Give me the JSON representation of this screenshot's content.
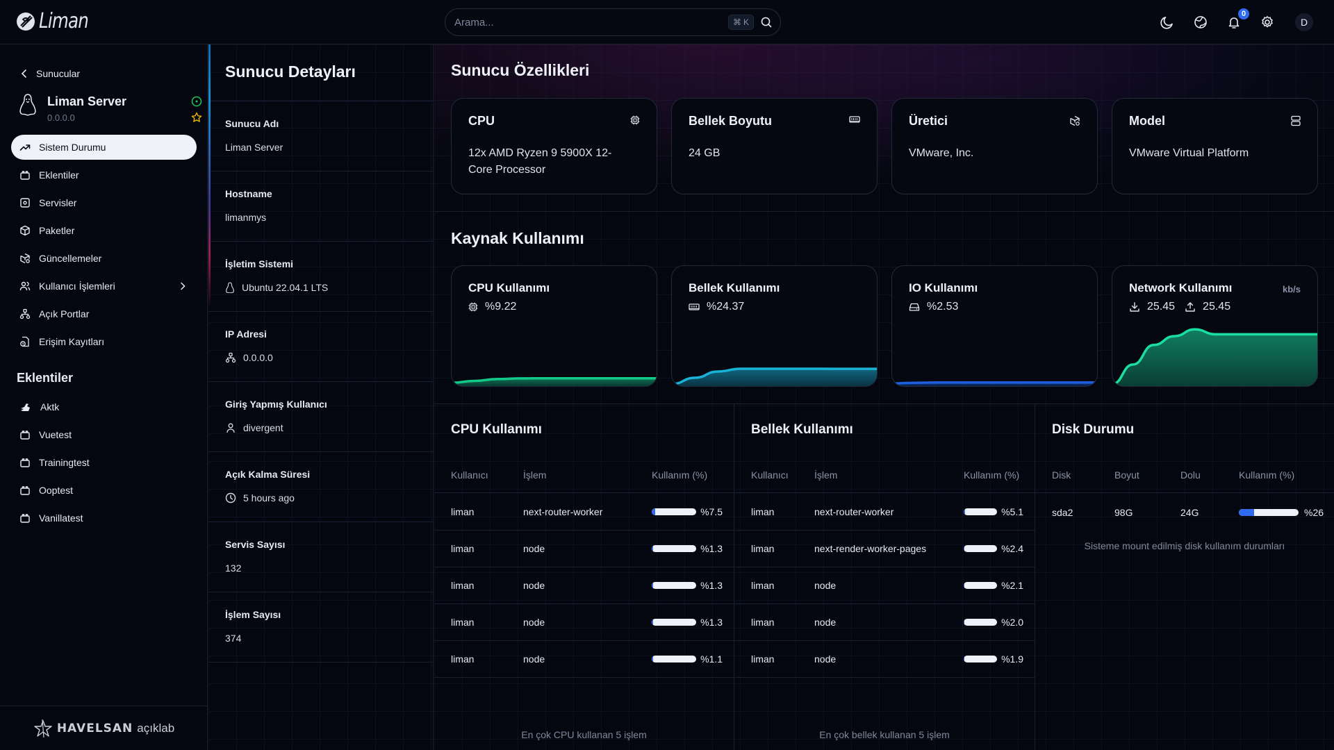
{
  "app": {
    "name": "Liman"
  },
  "search": {
    "placeholder": "Arama...",
    "shortcut_key": "K"
  },
  "topbar": {
    "notification_count": "0",
    "avatar_initial": "D"
  },
  "sidebar": {
    "back_label": "Sunucular",
    "server_name": "Liman Server",
    "server_ip": "0.0.0.0",
    "nav": [
      {
        "label": "Sistem Durumu",
        "icon": "trend-icon",
        "active": true
      },
      {
        "label": "Eklentiler",
        "icon": "plugin-icon"
      },
      {
        "label": "Servisler",
        "icon": "service-icon"
      },
      {
        "label": "Paketler",
        "icon": "package-icon"
      },
      {
        "label": "Güncellemeler",
        "icon": "update-icon"
      },
      {
        "label": "Kullanıcı İşlemleri",
        "icon": "users-icon",
        "has_submenu": true
      },
      {
        "label": "Açık Portlar",
        "icon": "network-icon"
      },
      {
        "label": "Erişim Kayıtları",
        "icon": "log-icon"
      }
    ],
    "plugins_title": "Eklentiler",
    "plugins": [
      {
        "label": "Aktk",
        "icon": "aktk-icon"
      },
      {
        "label": "Vuetest",
        "icon": "plugin-icon"
      },
      {
        "label": "Trainingtest",
        "icon": "plugin-icon"
      },
      {
        "label": "Ooptest",
        "icon": "plugin-icon"
      },
      {
        "label": "Vanillatest",
        "icon": "plugin-icon"
      }
    ],
    "footer": {
      "brand": "HAVELSAN",
      "sub": "açıklab"
    }
  },
  "details": {
    "title": "Sunucu Detayları",
    "items": [
      {
        "label": "Sunucu Adı",
        "value": "Liman Server"
      },
      {
        "label": "Hostname",
        "value": "limanmys"
      },
      {
        "label": "İşletim Sistemi",
        "value": "Ubuntu 22.04.1 LTS",
        "icon": "linux-icon"
      },
      {
        "label": "IP Adresi",
        "value": "0.0.0.0",
        "icon": "network-icon"
      },
      {
        "label": "Giriş Yapmış Kullanıcı",
        "value": "divergent",
        "icon": "user-icon"
      },
      {
        "label": "Açık Kalma Süresi",
        "value": "5 hours ago",
        "icon": "clock-icon"
      },
      {
        "label": "Servis Sayısı",
        "value": "132"
      },
      {
        "label": "İşlem Sayısı",
        "value": "374"
      }
    ]
  },
  "specs": {
    "title": "Sunucu Özellikleri",
    "cards": [
      {
        "label": "CPU",
        "value": "12x AMD Ryzen 9 5900X 12-Core Processor",
        "icon": "cpu-icon"
      },
      {
        "label": "Bellek Boyutu",
        "value": "24 GB",
        "icon": "memory-icon"
      },
      {
        "label": "Üretici",
        "value": "VMware, Inc.",
        "icon": "package-search-icon"
      },
      {
        "label": "Model",
        "value": "VMware Virtual Platform",
        "icon": "server-icon"
      }
    ]
  },
  "usage": {
    "title": "Kaynak Kullanımı",
    "cards": [
      {
        "label": "CPU Kullanımı",
        "value": "%9.22",
        "icon": "cpu-icon",
        "color": "#12c98a",
        "series": [
          2,
          5,
          8,
          9,
          9.2,
          9.2,
          9.1,
          9.2,
          9.2,
          9.22
        ]
      },
      {
        "label": "Bellek Kullanımı",
        "value": "%24.37",
        "icon": "memory-icon",
        "color": "#1ab3d8",
        "series": [
          0,
          10,
          20,
          24.5,
          24.5,
          24.4,
          24.4,
          24.37,
          24.37,
          24.37
        ]
      },
      {
        "label": "IO Kullanımı",
        "value": "%2.53",
        "icon": "disk-icon",
        "color": "#1d5fe0",
        "series": [
          1,
          2,
          2.5,
          2.5,
          2.5,
          2.53,
          2.53,
          2.53,
          2.53,
          2.53
        ]
      },
      {
        "label": "Network Kullanımı",
        "unit": "kb/s",
        "download": "25.45",
        "upload": "25.45",
        "color": "#19e0a0",
        "series": [
          0,
          10,
          20,
          24.5,
          28,
          25.45,
          25.45,
          25.45,
          25.45,
          25.45,
          25.45
        ]
      }
    ]
  },
  "cpu_table": {
    "title": "CPU Kullanımı",
    "headers": [
      "Kullanıcı",
      "İşlem",
      "Kullanım (%)"
    ],
    "rows": [
      {
        "user": "liman",
        "process": "next-router-worker",
        "percent_label": "%7.5",
        "percent": 7.5
      },
      {
        "user": "liman",
        "process": "node",
        "percent_label": "%1.3",
        "percent": 1.3
      },
      {
        "user": "liman",
        "process": "node",
        "percent_label": "%1.3",
        "percent": 1.3
      },
      {
        "user": "liman",
        "process": "node",
        "percent_label": "%1.3",
        "percent": 1.3
      },
      {
        "user": "liman",
        "process": "node",
        "percent_label": "%1.1",
        "percent": 1.1
      }
    ],
    "note": "En çok CPU kullanan 5 işlem"
  },
  "mem_table": {
    "title": "Bellek Kullanımı",
    "headers": [
      "Kullanıcı",
      "İşlem",
      "Kullanım (%)"
    ],
    "rows": [
      {
        "user": "liman",
        "process": "next-router-worker",
        "percent_label": "%5.1",
        "percent": 5.1
      },
      {
        "user": "liman",
        "process": "next-render-worker-pages",
        "percent_label": "%2.4",
        "percent": 2.4
      },
      {
        "user": "liman",
        "process": "node",
        "percent_label": "%2.1",
        "percent": 2.1
      },
      {
        "user": "liman",
        "process": "node",
        "percent_label": "%2.0",
        "percent": 2.0
      },
      {
        "user": "liman",
        "process": "node",
        "percent_label": "%1.9",
        "percent": 1.9
      }
    ],
    "note": "En çok bellek kullanan 5 işlem"
  },
  "disk_table": {
    "title": "Disk Durumu",
    "headers": [
      "Disk",
      "Boyut",
      "Dolu",
      "Kullanım (%)"
    ],
    "rows": [
      {
        "disk": "sda2",
        "size": "98G",
        "used": "24G",
        "percent_label": "%26",
        "percent": 26
      }
    ],
    "note": "Sisteme mount edilmiş disk kullanım durumları"
  }
}
